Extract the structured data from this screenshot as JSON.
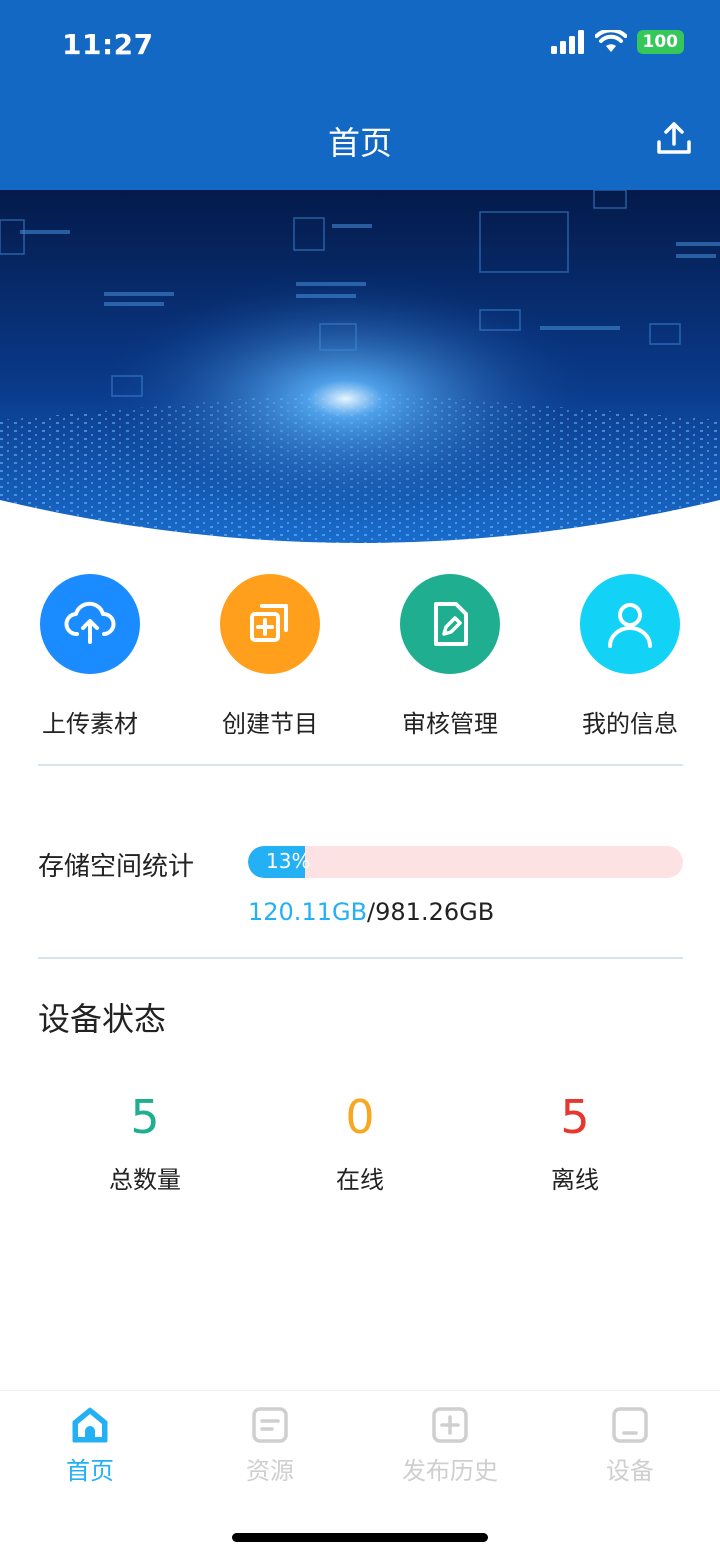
{
  "status": {
    "time": "11:27",
    "battery": "100"
  },
  "header": {
    "title": "首页"
  },
  "actions": [
    {
      "label": "上传素材",
      "icon": "cloud-upload-icon",
      "color": "#1a8cff"
    },
    {
      "label": "创建节目",
      "icon": "create-program-icon",
      "color": "#ff9f1c"
    },
    {
      "label": "审核管理",
      "icon": "document-edit-icon",
      "color": "#1fae8f"
    },
    {
      "label": "我的信息",
      "icon": "user-icon",
      "color": "#12d3f5"
    }
  ],
  "storage": {
    "label": "存储空间统计",
    "percent_text": "13%",
    "percent": 13,
    "used": "120.11GB",
    "separator": "/",
    "total": "981.26GB"
  },
  "devices": {
    "title": "设备状态",
    "stats": [
      {
        "value": "5",
        "caption": "总数量",
        "color": "#1fae8f"
      },
      {
        "value": "0",
        "caption": "在线",
        "color": "#f7a823"
      },
      {
        "value": "5",
        "caption": "离线",
        "color": "#e8372f"
      }
    ]
  },
  "tabs": [
    {
      "label": "首页",
      "icon": "home-icon",
      "active": true
    },
    {
      "label": "资源",
      "icon": "resource-icon",
      "active": false
    },
    {
      "label": "发布历史",
      "icon": "publish-history-icon",
      "active": false
    },
    {
      "label": "设备",
      "icon": "device-icon",
      "active": false
    }
  ],
  "colors": {
    "header": "#1368c4",
    "accent": "#23b0f5",
    "storage_track": "#fde2e4"
  }
}
